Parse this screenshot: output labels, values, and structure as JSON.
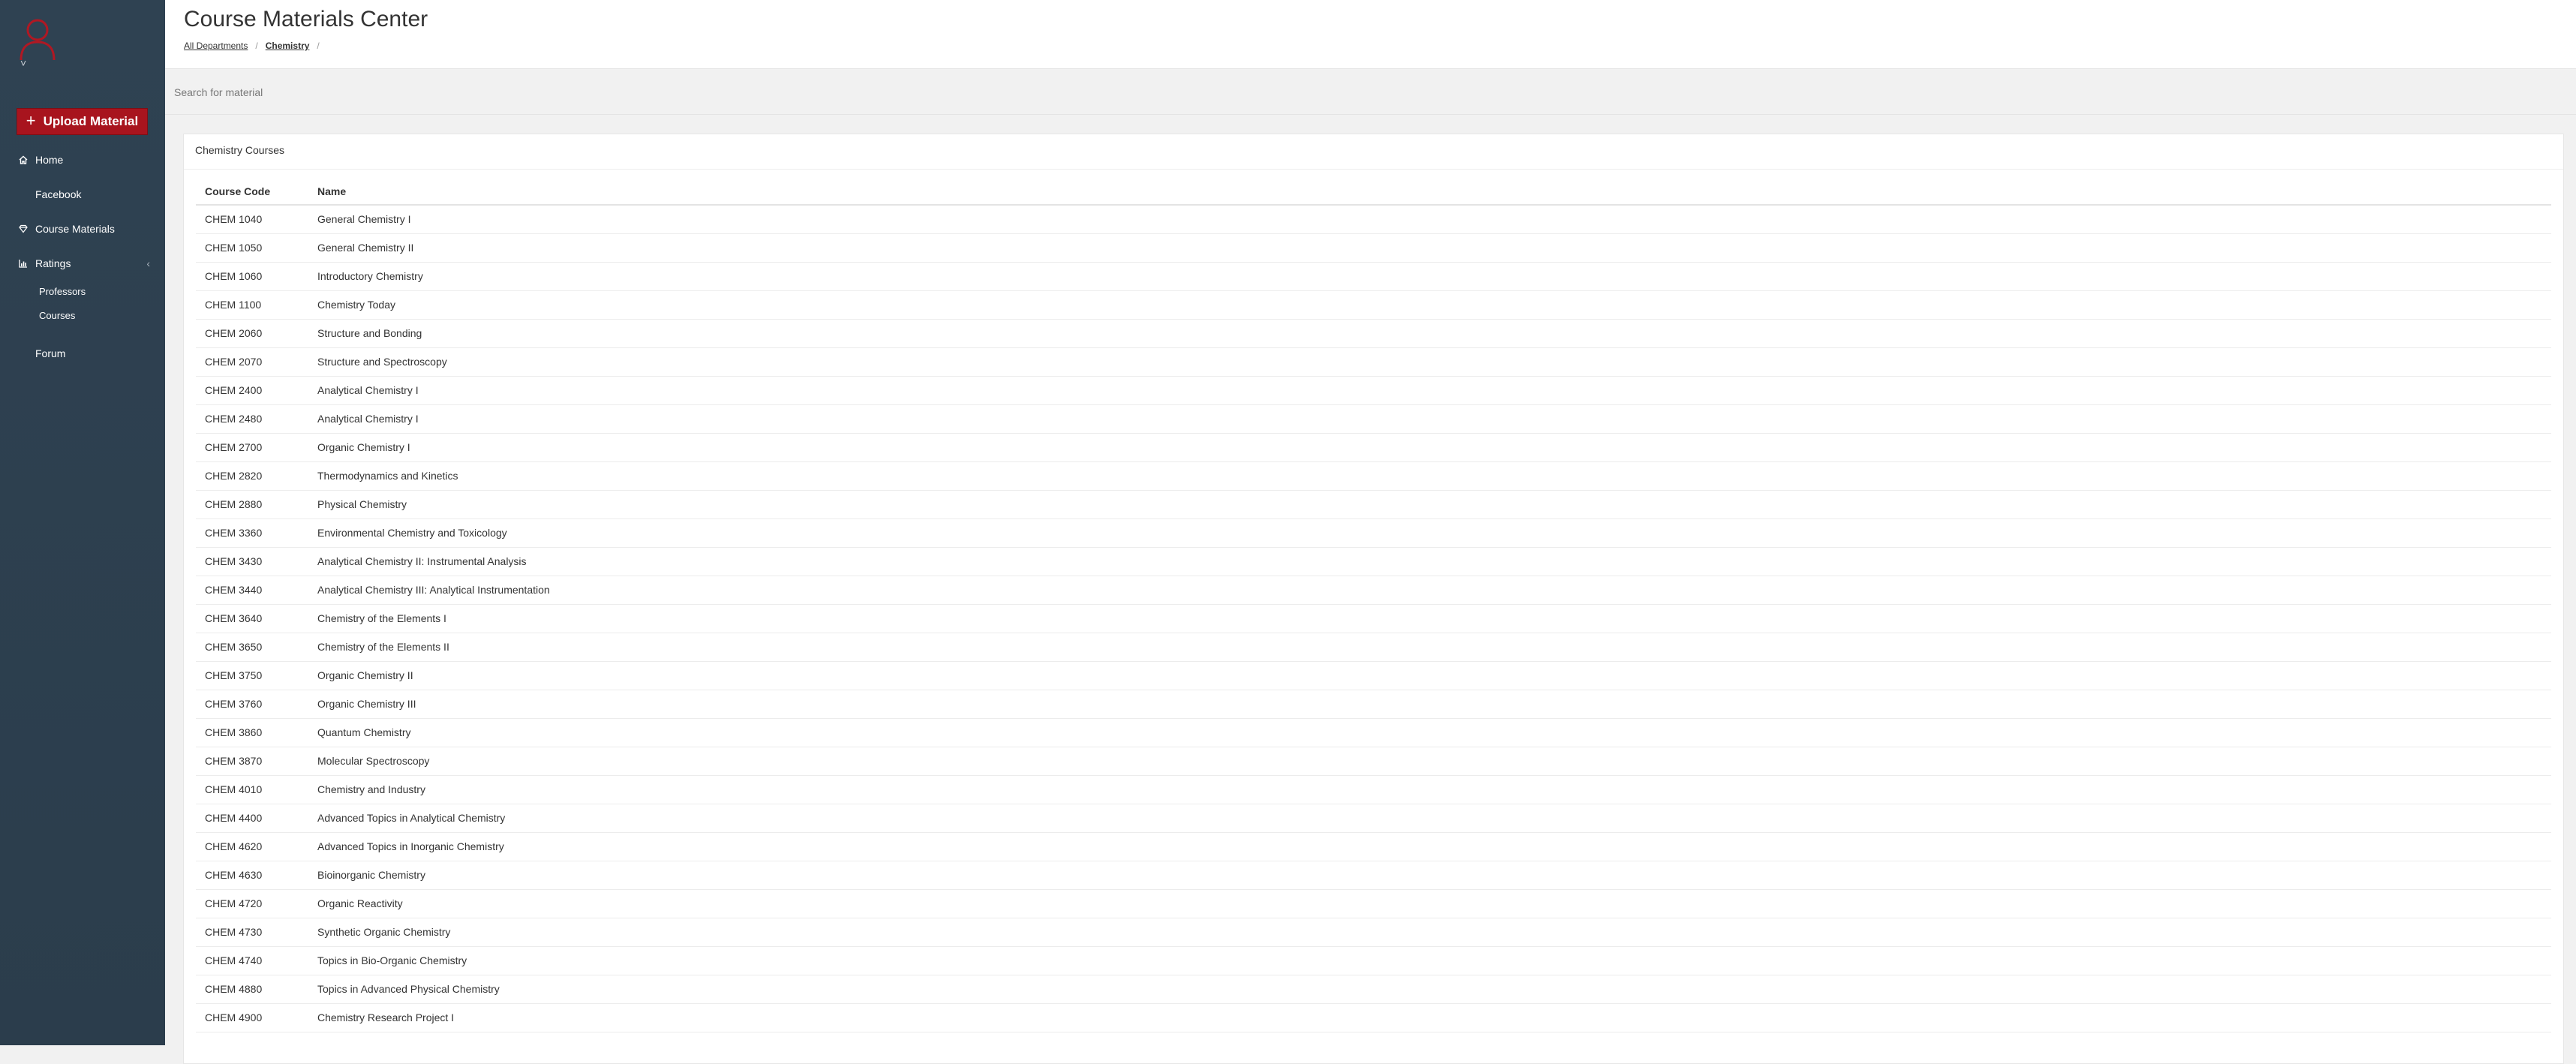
{
  "app": {
    "title": "Course Materials Center",
    "accent_color": "#a8141e",
    "sidebar_color": "#2f4252"
  },
  "sidebar": {
    "avatar_icon": "user-icon",
    "avatar_caret": "˅",
    "upload_button": {
      "icon": "plus-icon",
      "label": "Upload Material"
    },
    "nav": {
      "home": {
        "icon": "home-icon",
        "label": "Home"
      },
      "facebook": {
        "icon": "facebook-icon",
        "label": "Facebook"
      },
      "course_materials": {
        "icon": "diamond-icon",
        "label": "Course Materials"
      },
      "ratings": {
        "icon": "bar-chart-icon",
        "label": "Ratings",
        "caret": "‹",
        "children": {
          "professors": "Professors",
          "courses": "Courses"
        }
      },
      "forum": {
        "label": "Forum"
      }
    }
  },
  "breadcrumb": {
    "item0": "All Departments",
    "separator": "/",
    "item1": "Chemistry",
    "trailing": "/"
  },
  "search": {
    "placeholder": "Search for material"
  },
  "panel": {
    "title": "Chemistry Courses",
    "columns": {
      "code": "Course Code",
      "name": "Name"
    },
    "rows": [
      {
        "code": "CHEM 1040",
        "name": "General Chemistry I"
      },
      {
        "code": "CHEM 1050",
        "name": "General Chemistry II"
      },
      {
        "code": "CHEM 1060",
        "name": "Introductory Chemistry"
      },
      {
        "code": "CHEM 1100",
        "name": "Chemistry Today"
      },
      {
        "code": "CHEM 2060",
        "name": "Structure and Bonding"
      },
      {
        "code": "CHEM 2070",
        "name": "Structure and Spectroscopy"
      },
      {
        "code": "CHEM 2400",
        "name": "Analytical Chemistry I"
      },
      {
        "code": "CHEM 2480",
        "name": "Analytical Chemistry I"
      },
      {
        "code": "CHEM 2700",
        "name": "Organic Chemistry I"
      },
      {
        "code": "CHEM 2820",
        "name": "Thermodynamics and Kinetics"
      },
      {
        "code": "CHEM 2880",
        "name": "Physical Chemistry"
      },
      {
        "code": "CHEM 3360",
        "name": "Environmental Chemistry and Toxicology"
      },
      {
        "code": "CHEM 3430",
        "name": "Analytical Chemistry II: Instrumental Analysis"
      },
      {
        "code": "CHEM 3440",
        "name": "Analytical Chemistry III: Analytical Instrumentation"
      },
      {
        "code": "CHEM 3640",
        "name": "Chemistry of the Elements I"
      },
      {
        "code": "CHEM 3650",
        "name": "Chemistry of the Elements II"
      },
      {
        "code": "CHEM 3750",
        "name": "Organic Chemistry II"
      },
      {
        "code": "CHEM 3760",
        "name": "Organic Chemistry III"
      },
      {
        "code": "CHEM 3860",
        "name": "Quantum Chemistry"
      },
      {
        "code": "CHEM 3870",
        "name": "Molecular Spectroscopy"
      },
      {
        "code": "CHEM 4010",
        "name": "Chemistry and Industry"
      },
      {
        "code": "CHEM 4400",
        "name": "Advanced Topics in Analytical Chemistry"
      },
      {
        "code": "CHEM 4620",
        "name": "Advanced Topics in Inorganic Chemistry"
      },
      {
        "code": "CHEM 4630",
        "name": "Bioinorganic Chemistry"
      },
      {
        "code": "CHEM 4720",
        "name": "Organic Reactivity"
      },
      {
        "code": "CHEM 4730",
        "name": "Synthetic Organic Chemistry"
      },
      {
        "code": "CHEM 4740",
        "name": "Topics in Bio-Organic Chemistry"
      },
      {
        "code": "CHEM 4880",
        "name": "Topics in Advanced Physical Chemistry"
      },
      {
        "code": "CHEM 4900",
        "name": "Chemistry Research Project I"
      }
    ]
  }
}
